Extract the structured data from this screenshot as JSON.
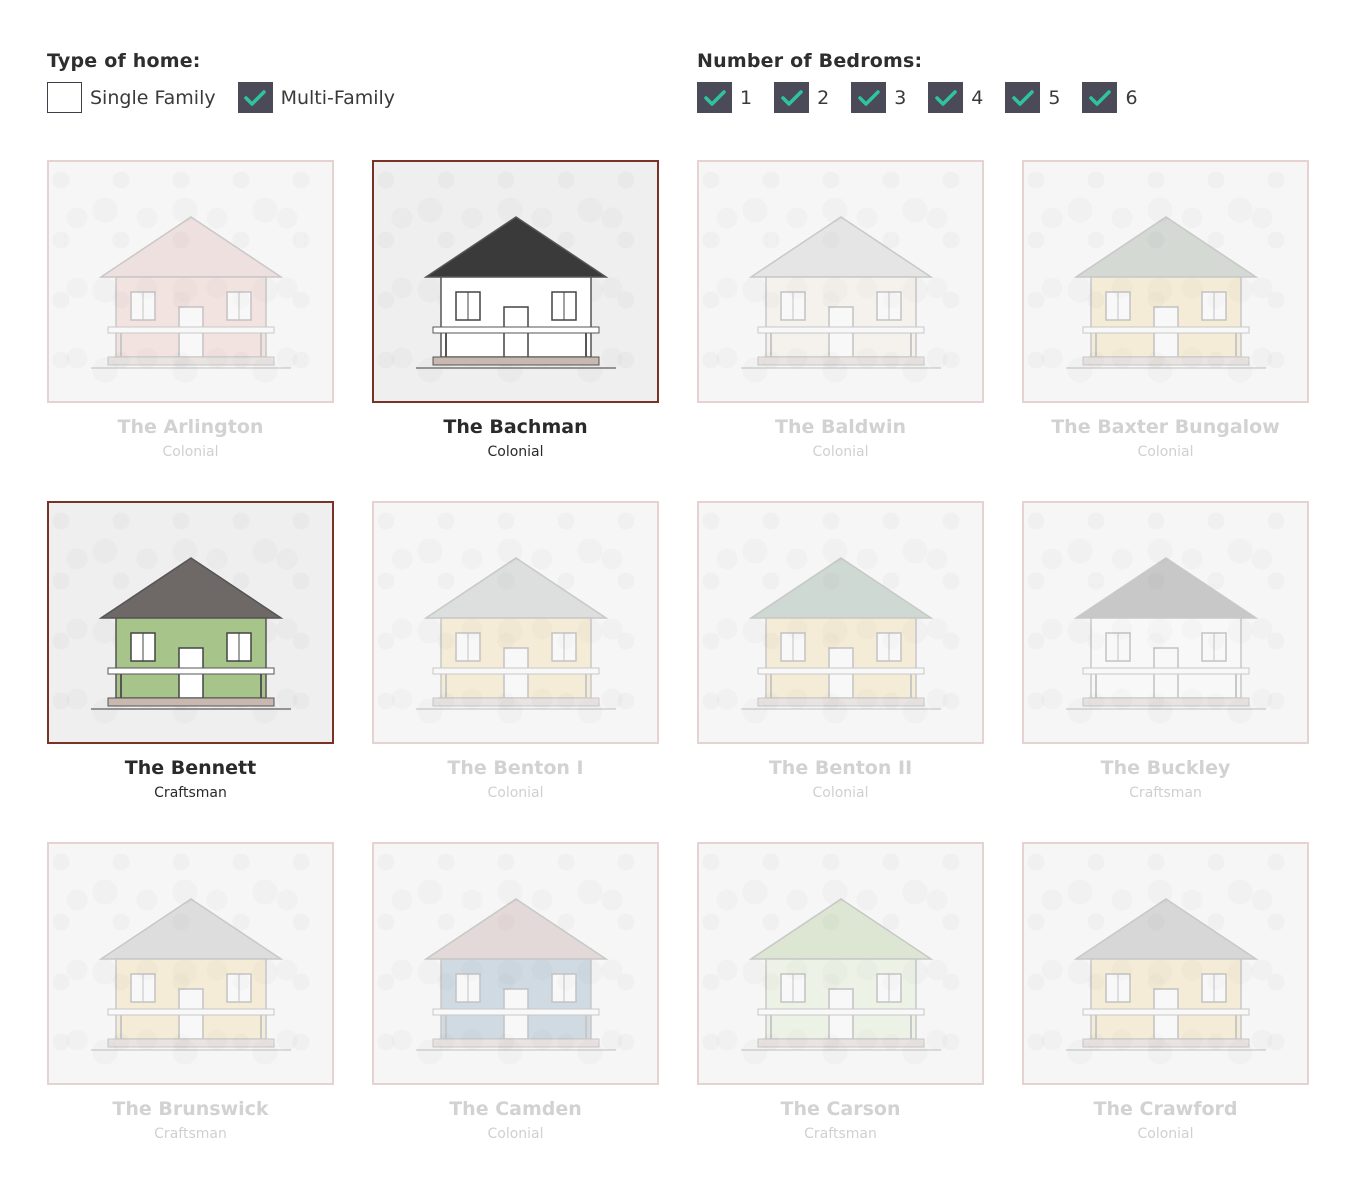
{
  "filters": {
    "type": {
      "title": "Type of home:",
      "options": [
        {
          "label": "Single Family",
          "checked": false
        },
        {
          "label": "Multi-Family",
          "checked": true
        }
      ]
    },
    "bedrooms": {
      "title": "Number of Bedroms:",
      "options": [
        {
          "label": "1",
          "checked": true
        },
        {
          "label": "2",
          "checked": true
        },
        {
          "label": "3",
          "checked": true
        },
        {
          "label": "4",
          "checked": true
        },
        {
          "label": "5",
          "checked": true
        },
        {
          "label": "6",
          "checked": true
        }
      ]
    }
  },
  "colors": {
    "checkbox_fill": "#4a4a58",
    "checkmark": "#2ec4a0",
    "active_border": "#7a3226",
    "inactive_border": "#e6d3d1"
  },
  "homes": [
    {
      "name": "The Arlington",
      "style": "Colonial",
      "active": false,
      "siding": "#e8b3ad",
      "roof": "#d9a8a3"
    },
    {
      "name": "The Bachman",
      "style": "Colonial",
      "active": true,
      "siding": "#ffffff",
      "roof": "#3a3a3a"
    },
    {
      "name": "The Baldwin",
      "style": "Colonial",
      "active": false,
      "siding": "#f3e6d8",
      "roof": "#bdbdbd"
    },
    {
      "name": "The Baxter Bungalow",
      "style": "Colonial",
      "active": false,
      "siding": "#f2d38a",
      "roof": "#7f8f7f"
    },
    {
      "name": "The Bennett",
      "style": "Craftsman",
      "active": true,
      "siding": "#a7c48a",
      "roof": "#6e6966"
    },
    {
      "name": "The Benton I",
      "style": "Colonial",
      "active": false,
      "siding": "#f2d38a",
      "roof": "#9aa7a0"
    },
    {
      "name": "The Benton II",
      "style": "Colonial",
      "active": false,
      "siding": "#f2d38a",
      "roof": "#6e8f7a"
    },
    {
      "name": "The Buckley",
      "style": "Craftsman",
      "active": false,
      "siding": "#ffffff",
      "roof": "#555555"
    },
    {
      "name": "The Brunswick",
      "style": "Craftsman",
      "active": false,
      "siding": "#f2d38a",
      "roof": "#a0a0a0"
    },
    {
      "name": "The Camden",
      "style": "Colonial",
      "active": false,
      "siding": "#6f94b3",
      "roof": "#b98f8f"
    },
    {
      "name": "The Carson",
      "style": "Craftsman",
      "active": false,
      "siding": "#d8e8c0",
      "roof": "#9ac07a"
    },
    {
      "name": "The Crawford",
      "style": "Colonial",
      "active": false,
      "siding": "#f2d38a",
      "roof": "#8a8a8a"
    }
  ]
}
